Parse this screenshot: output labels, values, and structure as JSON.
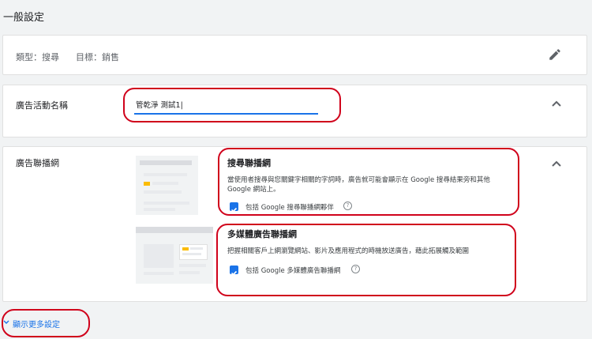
{
  "page_title": "一般設定",
  "summary": {
    "type_label": "類型：搜尋",
    "goal_label": "目標：銷售"
  },
  "campaign_name": {
    "label": "廣告活動名稱",
    "value": "管乾淨 測試1|"
  },
  "networks": {
    "label": "廣告聯播網",
    "search": {
      "title": "搜尋聯播網",
      "description": "當使用者搜尋與您關鍵字相關的字詞時，廣告就可能會顯示在 Google 搜尋結果旁和其他 Google 網站上。",
      "checkbox_label": "包括 Google 搜尋聯播網夥伴",
      "help_glyph": "?"
    },
    "display": {
      "title": "多媒體廣告聯播網",
      "description": "把握相關客戶上網瀏覽網站、影片及應用程式的時機放送廣告，藉此拓展觸及範圍",
      "checkbox_label": "包括 Google 多媒體廣告聯播網",
      "help_glyph": "?"
    }
  },
  "show_more_label": "顯示更多設定",
  "icons": {
    "edit": "pencil-icon",
    "collapse": "chevron-up-icon",
    "expand": "chevron-down-icon",
    "checked": "check-icon"
  },
  "colors": {
    "accent": "#1a73e8",
    "highlight": "#d0021b",
    "thumb_yellow": "#fbbc04"
  }
}
